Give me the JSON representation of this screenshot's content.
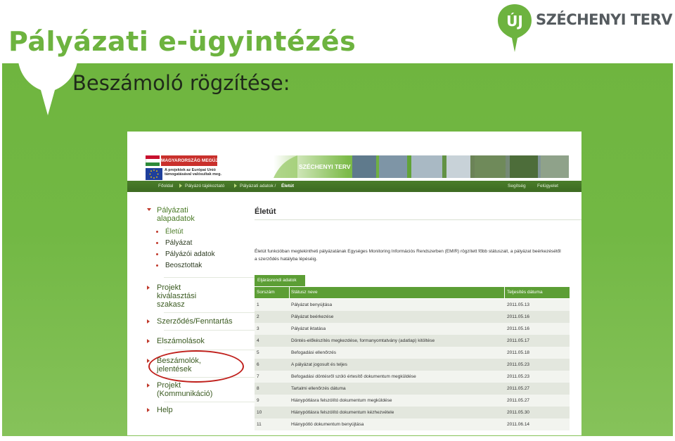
{
  "slide": {
    "title": "Pályázati e-ügyintézés",
    "subtitle": "Beszámoló rögzítése:",
    "logo_mark": "ÚJ",
    "logo_text": "SZÉCHENYI TERV"
  },
  "colors": {
    "brand_green": "#6db33f",
    "dark_green": "#3d6a22",
    "highlight_red": "#c0201c"
  },
  "portal": {
    "flag_label": "MAGYARORSZÁG MEGÚJUL",
    "eu_text": "A projektek az Európai Unió támogatásával valósultak meg.",
    "banner_text": "SZÉCHENYI TERV",
    "breadcrumb": [
      "Főoldal",
      "Pályázó tájékoztató",
      "Pályázati adatok / ",
      "Életút"
    ],
    "nav_right": [
      "Segítség",
      "Felügyelet"
    ],
    "sidebar": {
      "group_title": "Pályázati alapadatok",
      "sub_items": [
        "Életút",
        "Pályázat",
        "Pályázói adatok",
        "Beosztottak"
      ],
      "items": [
        "Projekt kiválasztási szakasz",
        "Szerződés/Fenntartás",
        "Elszámolások",
        "Beszámolók, jelentések",
        "Projekt (Kommunikáció)",
        "Help"
      ]
    },
    "page_title": "Életút",
    "description": "Életút funkcióban megtekintheti pályázatának Egységes Monitoring Információs Rendszerben (EMIR) rögzített főbb státuszait, a pályázat beérkezésétől a szerződés hatályba lépéséig.",
    "tab_label": "Eljárásrendi adatok",
    "table": {
      "headers": [
        "Sorszám",
        "Státusz neve",
        "Teljesítés dátuma"
      ],
      "rows": [
        [
          "1",
          "Pályázat benyújtása",
          "2011.05.13"
        ],
        [
          "2",
          "Pályázat beérkezése",
          "2011.05.16"
        ],
        [
          "3",
          "Pályázat iktatása",
          "2011.05.16"
        ],
        [
          "4",
          "Döntés-előkészítés megkezdése, formanyomtatvány (adatlap) kitöltése",
          "2011.05.17"
        ],
        [
          "5",
          "Befogadási ellenőrzés",
          "2011.05.18"
        ],
        [
          "6",
          "A pályázat jogosult és teljes",
          "2011.05.23"
        ],
        [
          "7",
          "Befogadási döntésről szóló értesítő dokumentum megküldése",
          "2011.05.23"
        ],
        [
          "8",
          "Tartalmi ellenőrzés dátuma",
          "2011.05.27"
        ],
        [
          "9",
          "Hiánypótlásra felszólító dokumentum megküldése",
          "2011.05.27"
        ],
        [
          "10",
          "Hiánypótlásra felszólító dokumentum kézhezvétele",
          "2011.05.30"
        ],
        [
          "11",
          "Hiánypótló dokumentum benyújtása",
          "2011.06.14"
        ]
      ]
    }
  }
}
